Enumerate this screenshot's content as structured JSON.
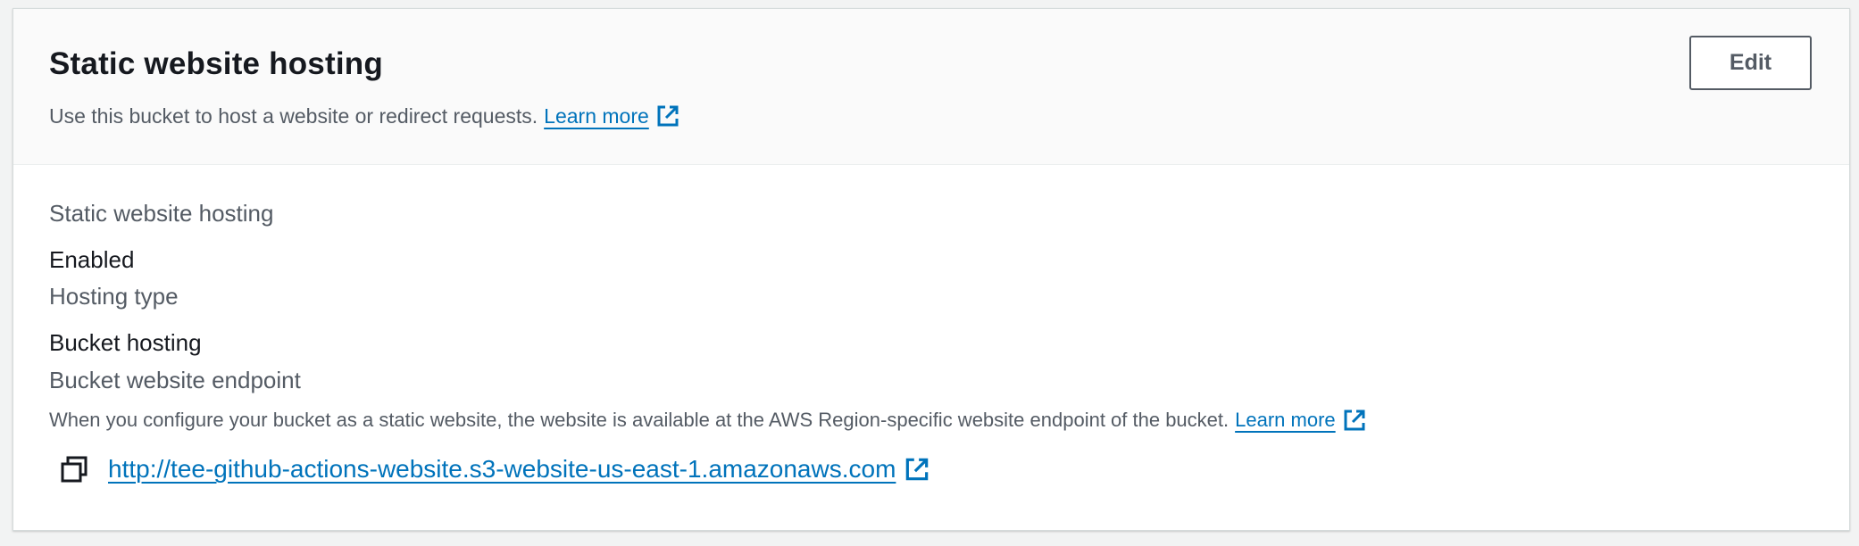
{
  "header": {
    "title": "Static website hosting",
    "description": "Use this bucket to host a website or redirect requests.",
    "learn_more": "Learn more",
    "edit_label": "Edit"
  },
  "fields": {
    "hosting_label": "Static website hosting",
    "hosting_value": "Enabled",
    "type_label": "Hosting type",
    "type_value": "Bucket hosting",
    "endpoint_label": "Bucket website endpoint",
    "endpoint_desc": "When you configure your bucket as a static website, the website is available at the AWS Region-specific website endpoint of the bucket.",
    "endpoint_learn_more": "Learn more",
    "endpoint_url": "http://tee-github-actions-website.s3-website-us-east-1.amazonaws.com"
  },
  "icons": {
    "external": "external-link-icon",
    "copy": "copy-icon"
  },
  "colors": {
    "link": "#0073bb",
    "text": "#16191f",
    "secondary_text": "#545b64",
    "header_bg": "#fafafa"
  }
}
